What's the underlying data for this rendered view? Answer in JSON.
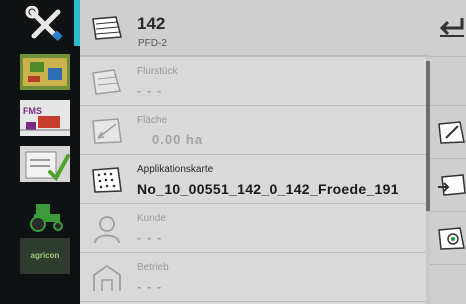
{
  "header": {
    "title": "142",
    "subtitle": "PFD-2"
  },
  "nav": {
    "items": [
      {
        "name": "settings-tools"
      },
      {
        "name": "field-map"
      },
      {
        "name": "fms-farm"
      },
      {
        "name": "task-list"
      },
      {
        "name": "tractor"
      },
      {
        "name": "agricon",
        "label": "agricon"
      }
    ]
  },
  "rows": [
    {
      "label": "Flurstück",
      "value": "- - -"
    },
    {
      "label": "Fläche",
      "value": "0.00 ha"
    },
    {
      "label": "Applikationskarte",
      "value": "No_10_00551_142_0_142_Froede_191"
    },
    {
      "label": "Kunde",
      "value": "- - -"
    },
    {
      "label": "Betrieb",
      "value": "- - -"
    }
  ],
  "colors": {
    "accent": "#2dbbd0",
    "panel": "#d9d9d9",
    "nav_bg": "#0e1213"
  }
}
